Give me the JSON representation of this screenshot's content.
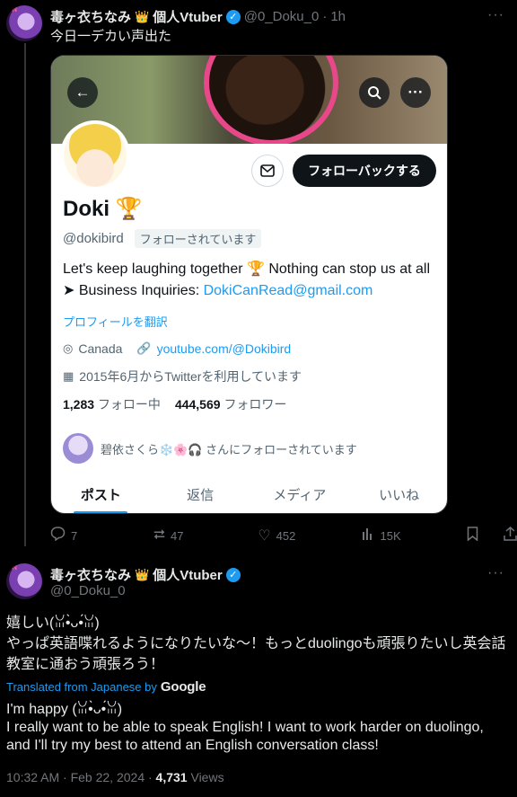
{
  "post1": {
    "author_name": "毒ヶ衣ちなみ",
    "author_suffix": "個人Vtuber",
    "handle": "@0_Doku_0",
    "separator": "·",
    "time_ago": "1h",
    "text": "今日一デカい声出た",
    "menu": "···",
    "actions": {
      "replies": "7",
      "reposts": "47",
      "likes": "452",
      "views": "15K"
    }
  },
  "profile_card": {
    "name": "Doki",
    "name_emoji": "🏆",
    "handle": "@dokibird",
    "follows_you": "フォローされています",
    "follow_back_label": "フォローバックする",
    "bio_text": "Let's keep laughing together 🏆 Nothing can stop us at all ➤ Business Inquiries: ",
    "bio_email": "DokiCanRead@gmail.com",
    "translate_profile": "プロフィールを翻訳",
    "location": "Canada",
    "website": "youtube.com/@Dokibird",
    "joined": "2015年6月からTwitterを利用しています",
    "following_count": "1,283",
    "following_label": "フォロー中",
    "followers_count": "444,569",
    "followers_label": "フォロワー",
    "followed_by_text": "碧依さくら❄️🌸🎧 さんにフォローされています",
    "tabs": [
      "ポスト",
      "返信",
      "メディア",
      "いいね"
    ]
  },
  "post2": {
    "author_name": "毒ヶ衣ちなみ",
    "author_suffix": "個人Vtuber",
    "handle": "@0_Doku_0",
    "menu": "···",
    "text_jp": "嬉しい(ꈍ•̀ᴗ•́ꈍ)\nやっぱ英語喋れるようになりたいな〜！もっとduolingoも頑張りたいし英会話教室に通おう頑張ろう！",
    "translated_by": "Translated from Japanese by",
    "google": "Google",
    "text_en": "I'm happy (ꈍ•̀ᴗ•́ꈍ)\nI really want to be able to speak English! I want to work harder on duolingo, and I'll try my best to attend an English conversation class!",
    "time": "10:32 AM · Feb 22, 2024 · ",
    "views_count": "4,731",
    "views_label": " Views"
  },
  "colors": {
    "accent": "#1d9bf0",
    "background": "#000000",
    "muted": "#71767b"
  }
}
